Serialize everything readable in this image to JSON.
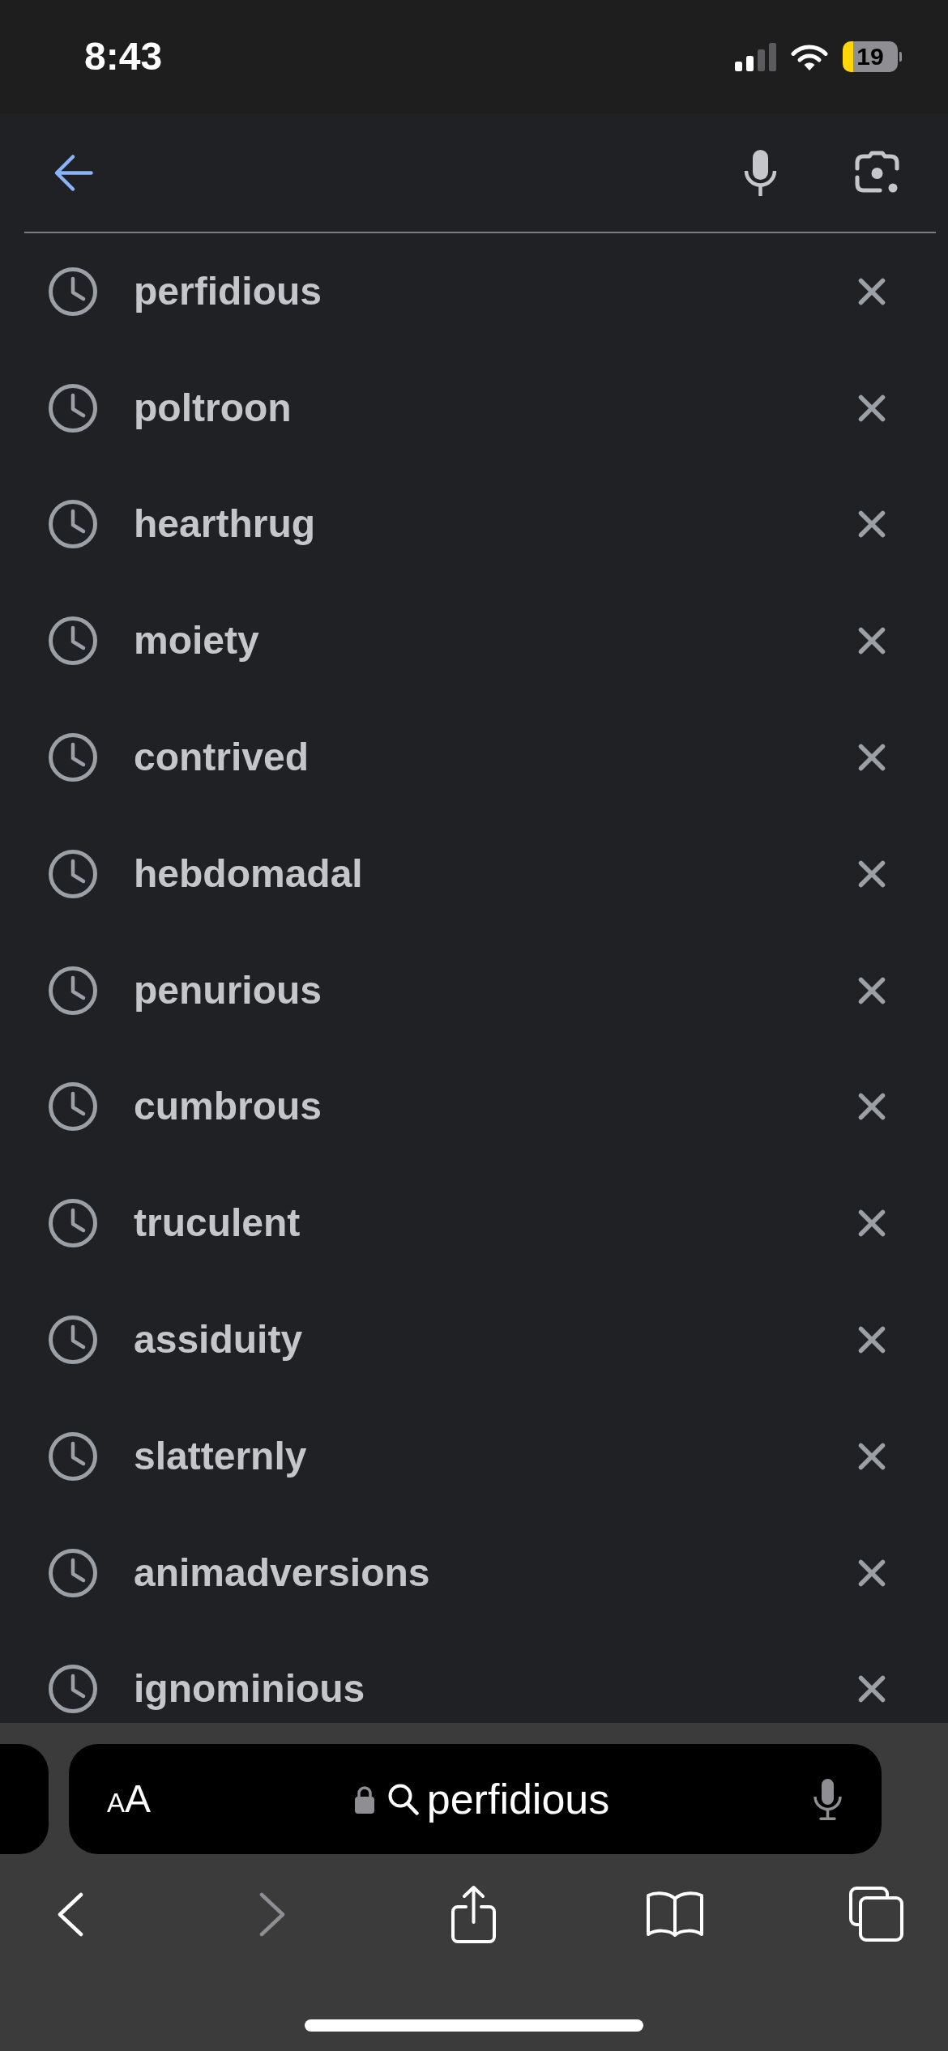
{
  "status_bar": {
    "time": "8:43",
    "battery": "19"
  },
  "history": [
    {
      "text": "perfidious"
    },
    {
      "text": "poltroon"
    },
    {
      "text": "hearthrug"
    },
    {
      "text": "moiety"
    },
    {
      "text": "contrived"
    },
    {
      "text": "hebdomadal"
    },
    {
      "text": "penurious"
    },
    {
      "text": "cumbrous"
    },
    {
      "text": "truculent"
    },
    {
      "text": "assiduity"
    },
    {
      "text": "slatternly"
    },
    {
      "text": "animadversions"
    },
    {
      "text": "ignominious"
    }
  ],
  "browser_toolbar": {
    "text_size_button": "AA",
    "address": "perfidious",
    "nav_buttons": [
      {
        "kind": "back",
        "disabled": false
      },
      {
        "kind": "forward",
        "disabled": true
      },
      {
        "kind": "share",
        "disabled": false
      },
      {
        "kind": "bookmarks",
        "disabled": false
      },
      {
        "kind": "tabs",
        "disabled": false
      }
    ]
  }
}
